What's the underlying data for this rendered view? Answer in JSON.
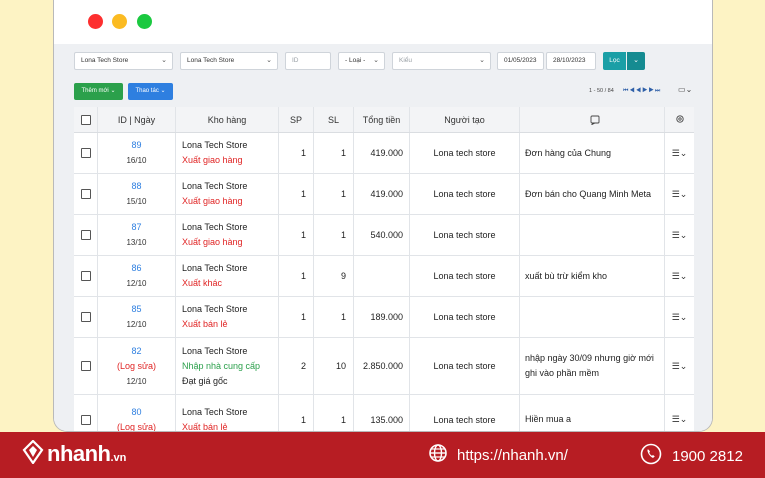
{
  "window": {
    "controls": [
      "close",
      "minimize",
      "maximize"
    ]
  },
  "filters": {
    "store_1": "Lona Tech Store",
    "store_2": "Lona Tech Store",
    "id_placeholder": "ID",
    "type": "- Loại -",
    "kind_placeholder": "Kiểu",
    "date_from": "01/05/2023",
    "date_to": "28/10/2023",
    "filter_button": "Lọc"
  },
  "toolbar": {
    "add_new": "Thêm mới",
    "actions": "Thao tác",
    "pagination": "1 - 50 / 84",
    "pager_icons": [
      "first-page-icon",
      "prev-page-icon",
      "next-page-icon",
      "last-page-icon"
    ]
  },
  "table": {
    "headers": [
      "",
      "ID | Ngày",
      "Kho hàng",
      "SP",
      "SL",
      "Tổng tiền",
      "Người tạo",
      "note-icon",
      "gear-icon"
    ],
    "rows": [
      {
        "id": "89",
        "log": "",
        "date": "16/10",
        "warehouse": "Lona Tech Store",
        "type": "Xuất giao hàng",
        "type_color": "red",
        "extra": "",
        "sp": "1",
        "sl": "1",
        "total": "419.000",
        "creator": "Lona tech store",
        "note": "Đơn hàng của Chung"
      },
      {
        "id": "88",
        "log": "",
        "date": "15/10",
        "warehouse": "Lona Tech Store",
        "type": "Xuất giao hàng",
        "type_color": "red",
        "extra": "",
        "sp": "1",
        "sl": "1",
        "total": "419.000",
        "creator": "Lona tech store",
        "note": "Đơn bán cho Quang Minh Meta"
      },
      {
        "id": "87",
        "log": "",
        "date": "13/10",
        "warehouse": "Lona Tech Store",
        "type": "Xuất giao hàng",
        "type_color": "red",
        "extra": "",
        "sp": "1",
        "sl": "1",
        "total": "540.000",
        "creator": "Lona tech store",
        "note": ""
      },
      {
        "id": "86",
        "log": "",
        "date": "12/10",
        "warehouse": "Lona Tech Store",
        "type": "Xuất khác",
        "type_color": "red",
        "extra": "",
        "sp": "1",
        "sl": "9",
        "total": "",
        "creator": "Lona tech store",
        "note": "xuất bù trừ kiểm kho"
      },
      {
        "id": "85",
        "log": "",
        "date": "12/10",
        "warehouse": "Lona Tech Store",
        "type": "Xuất bán lẻ",
        "type_color": "red",
        "extra": "",
        "sp": "1",
        "sl": "1",
        "total": "189.000",
        "creator": "Lona tech store",
        "note": ""
      },
      {
        "id": "82",
        "log": "(Log sửa)",
        "date": "12/10",
        "warehouse": "Lona Tech Store",
        "type": "Nhập nhà cung cấp",
        "type_color": "green",
        "extra": "Đạt giá gốc",
        "sp": "2",
        "sl": "10",
        "total": "2.850.000",
        "creator": "Lona tech store",
        "note": "nhập ngày 30/09 nhưng giờ mới ghi vào phần mềm"
      },
      {
        "id": "80",
        "log": "(Log sửa)",
        "date": "",
        "warehouse": "Lona Tech Store",
        "type": "Xuất bán lẻ",
        "type_color": "red",
        "extra": "",
        "sp": "1",
        "sl": "1",
        "total": "135.000",
        "creator": "Lona tech store",
        "note": "Hiền mua a"
      }
    ]
  },
  "footer": {
    "brand": "nhanh",
    "brand_suffix": ".vn",
    "website": "https://nhanh.vn/",
    "hotline": "1900 2812",
    "colors": {
      "background": "#b71d23",
      "text": "#ffffff"
    }
  }
}
